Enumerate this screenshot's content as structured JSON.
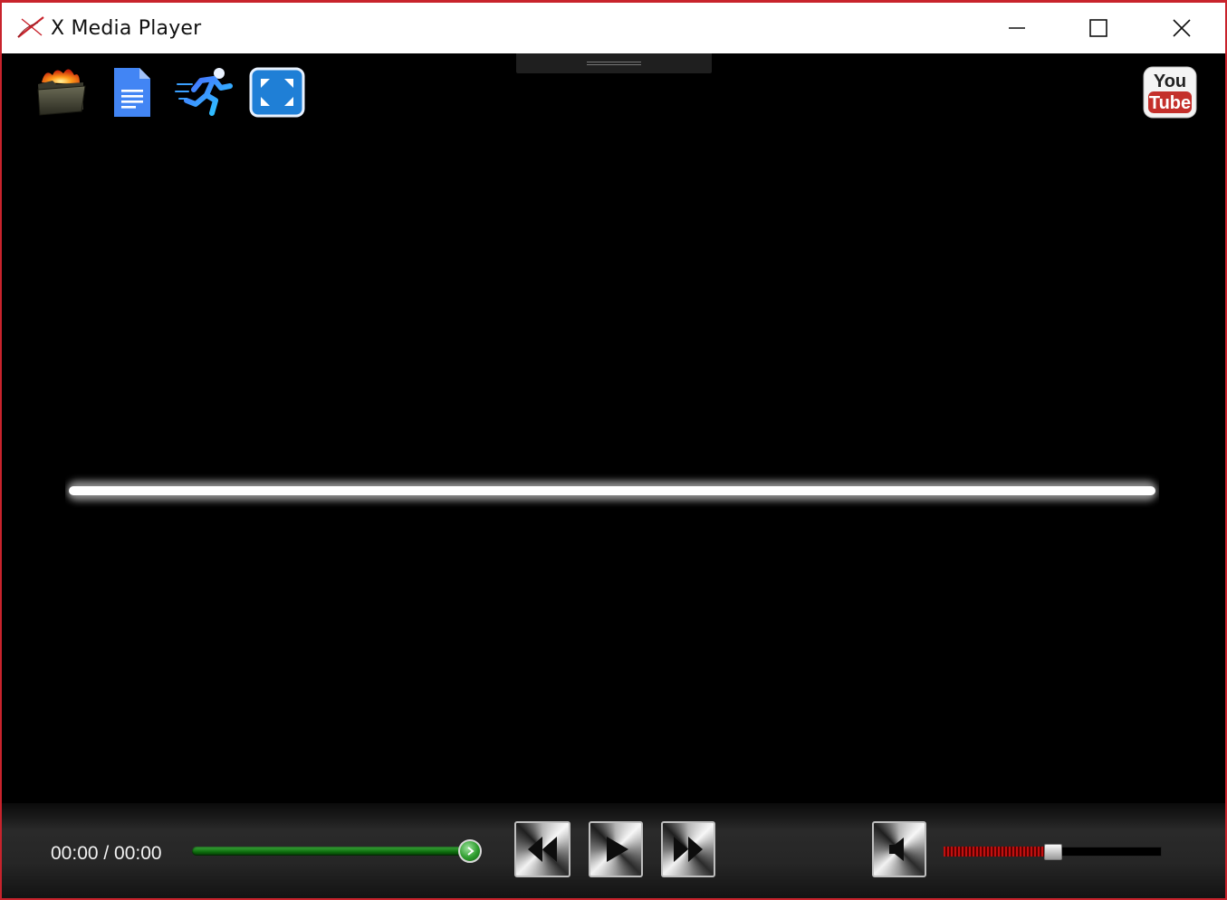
{
  "window": {
    "title": "X Media Player",
    "border_color": "#c8232c"
  },
  "toolbar": {
    "items": [
      {
        "name": "open-folder",
        "icon": "folder-flame-icon"
      },
      {
        "name": "playlist",
        "icon": "document-icon"
      },
      {
        "name": "speed",
        "icon": "running-man-icon"
      },
      {
        "name": "fullscreen",
        "icon": "expand-icon"
      },
      {
        "name": "youtube",
        "icon": "youtube-icon"
      }
    ],
    "youtube": {
      "line1": "You",
      "line2": "Tube"
    }
  },
  "player": {
    "time_display": "00:00 / 00:00",
    "seek_progress": 1.0,
    "volume_level": 0.5,
    "visualizer": "rainbow-waveform"
  },
  "controls": {
    "rewind_icon": "rewind-icon",
    "play_icon": "play-icon",
    "forward_icon": "fast-forward-icon",
    "mute_icon": "speaker-icon"
  },
  "colors": {
    "seek": "#2f9d2f",
    "volume": "#c21010",
    "background": "#000000"
  }
}
